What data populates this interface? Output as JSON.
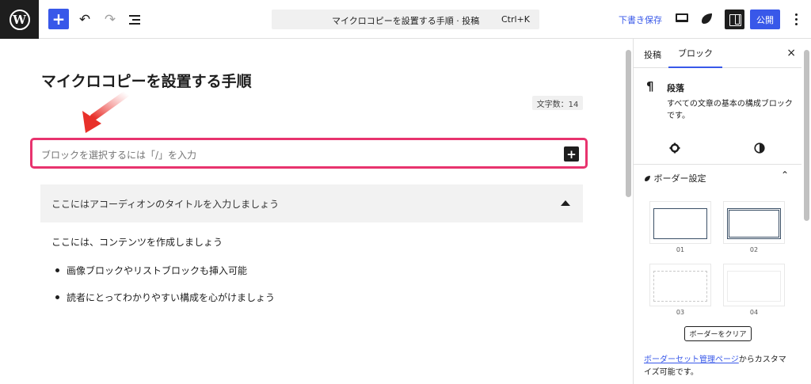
{
  "header": {
    "logo_letter": "W",
    "add_block_label": "+",
    "undo_glyph": "↶",
    "redo_glyph": "↷",
    "command_title": "マイクロコピーを設置する手順 · 投稿",
    "command_shortcut": "Ctrl+K",
    "save_draft_label": "下書き保存",
    "publish_label": "公開"
  },
  "editor": {
    "post_title": "マイクロコピーを設置する手順",
    "word_count": "文字数：14",
    "block_placeholder": "ブロックを選択するには「/」を入力",
    "inserter_label": "+",
    "accordion_title": "ここにはアコーディオンのタイトルを入力しましょう",
    "accordion_text": "ここには、コンテンツを作成しましょう",
    "list_items": [
      "画像ブロックやリストブロックも挿入可能",
      "読者にとってわかりやすい構成を心がけましょう"
    ]
  },
  "sidebar": {
    "tab_post": "投稿",
    "tab_block": "ブロック",
    "close_glyph": "×",
    "block_icon_glyph": "¶",
    "block_title": "段落",
    "block_description": "すべての文章の基本の構成ブロックです。",
    "border_section_title": "ボーダー設定",
    "border_options": [
      "01",
      "02",
      "03",
      "04"
    ],
    "clear_button": "ボーダーをクリア",
    "note_link": "ボーダーセット管理ページ",
    "note_text": "からカスタマイズ可能です。"
  },
  "colors": {
    "accent": "#3858e9",
    "highlight": "#e8336e",
    "dark": "#1e1e1e"
  },
  "icons": [
    "wordpress-logo-icon",
    "plus-icon",
    "undo-icon",
    "redo-icon",
    "list-view-icon",
    "preview-icon",
    "styles-icon",
    "settings-panel-icon",
    "more-options-icon",
    "close-icon",
    "pilcrow-icon",
    "gear-icon",
    "contrast-icon",
    "chevron-up-icon",
    "arrow-annotation-icon"
  ]
}
